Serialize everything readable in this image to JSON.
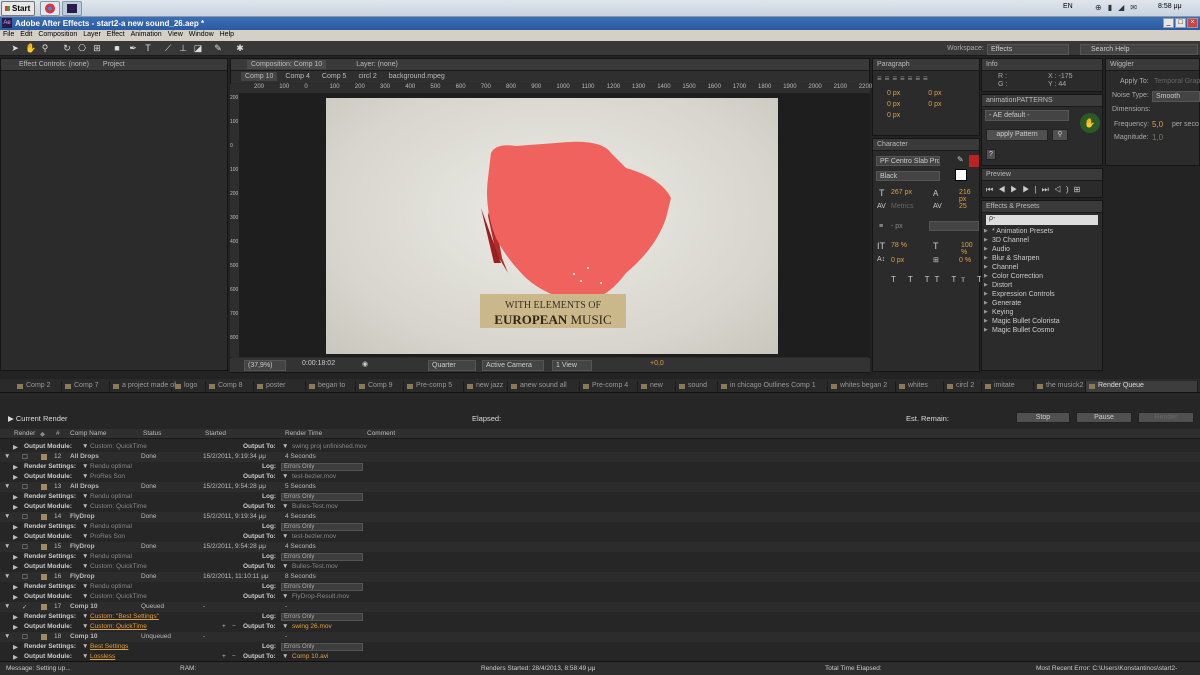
{
  "taskbar": {
    "start": "Start",
    "lang": "EN",
    "clock": "8:58 μμ"
  },
  "window": {
    "title": "Adobe After Effects - start2-a new sound_26.aep *",
    "icon": "Ae"
  },
  "menu": [
    "File",
    "Edit",
    "Composition",
    "Layer",
    "Effect",
    "Animation",
    "View",
    "Window",
    "Help"
  ],
  "workspace": {
    "label": "Workspace:",
    "value": "Effects",
    "search": "Search Help"
  },
  "left_panel": {
    "tab1": "Effect Controls: (none)",
    "tab2": "Project"
  },
  "comp_panel": {
    "tab": "Composition: Comp 10",
    "layer": "Layer: (none)",
    "subtabs": [
      "Comp 10",
      "Comp 4",
      "Comp 5",
      "circl 2",
      "background.mpeg"
    ],
    "ruler_top": [
      "200",
      "100",
      "0",
      "100",
      "200",
      "300",
      "400",
      "500",
      "600",
      "700",
      "800",
      "900",
      "1000",
      "1100",
      "1200",
      "1300",
      "1400",
      "1500",
      "1600",
      "1700",
      "1800",
      "1900",
      "2000",
      "2100",
      "2200"
    ],
    "ruler_left": [
      "200",
      "100",
      "0",
      "100",
      "200",
      "300",
      "400",
      "500",
      "600",
      "700",
      "800"
    ],
    "zoom": "(37,9%)",
    "timecode": "0:00:18:02",
    "quality": "Quarter",
    "camera": "Active Camera",
    "view": "1 View",
    "exposure": "+0,0"
  },
  "canvas_text": {
    "line1": "WITH ELEMENTS OF",
    "line2a": "EUROPEAN",
    "line2b": "MUSIC"
  },
  "paragraph": {
    "title": "Paragraph",
    "v1": "0 px",
    "v2": "0 px",
    "v3": "0 px",
    "v4": "0 px",
    "v5": "0 px"
  },
  "info": {
    "title": "Info",
    "r": "R :",
    "g": "G :",
    "x": "X : -175",
    "y": "Y : 44"
  },
  "wiggler": {
    "title": "Wiggler",
    "apply_to": "Apply To:",
    "apply_val": "Temporal Graph",
    "noise": "Noise Type:",
    "noise_val": "Smooth",
    "dims": "Dimensions:",
    "freq": "Frequency:",
    "freq_val": "5,0",
    "per": "per seco",
    "mag": "Magnitude:",
    "mag_val": "1,0"
  },
  "anim": {
    "title": "animationPATTERNS",
    "preset": "- AE default -",
    "apply": "apply Pattern",
    "help": "?"
  },
  "character": {
    "title": "Character",
    "font": "PF Centro Slab Pro",
    "style": "Black",
    "size": "267 px",
    "leading": "216 px",
    "metrics": "Metrics",
    "tracking": "25",
    "stroke": "- px",
    "vscale": "78 %",
    "hscale": "100 %",
    "baseline": "0 px",
    "tsume": "0 %"
  },
  "preview": {
    "title": "Preview"
  },
  "effects": {
    "title": "Effects & Presets",
    "search": "ρ-",
    "items": [
      "* Animation Presets",
      "3D Channel",
      "Audio",
      "Blur & Sharpen",
      "Channel",
      "Color Correction",
      "Distort",
      "Expression Controls",
      "Generate",
      "Keying",
      "Magic Bullet Colorista",
      "Magic Bullet Cosmo"
    ]
  },
  "timeline_tabs": [
    "Comp 2",
    "Comp 7",
    "a project made of",
    "logo",
    "Comp 8",
    "poster",
    "began to",
    "Comp 9",
    "Pre-comp 5",
    "new jazz",
    "anew sound all",
    "Pre-comp 4",
    "new",
    "sound",
    "in chicago Outlines Comp 1",
    "whites began 2",
    "whites",
    "circl 2",
    "imitate",
    "the musick2",
    "Render Queue"
  ],
  "render": {
    "current": "Current Render",
    "elapsed": "Elapsed:",
    "remain": "Est. Remain:",
    "stop": "Stop",
    "pause": "Pause",
    "render": "Render",
    "cols": [
      "Render",
      "#",
      "Comp Name",
      "Status",
      "Started",
      "Render Time",
      "Comment"
    ],
    "rows": [
      {
        "t": "om",
        "label": "Output Module:",
        "val": "Custom: QuickTime",
        "out": "swing proj unfinished.mov"
      },
      {
        "t": "item",
        "num": "12",
        "name": "All Drops",
        "status": "Done",
        "started": "15/2/2011, 9:19:34 μμ",
        "time": "4 Seconds"
      },
      {
        "t": "rs",
        "label": "Render Settings:",
        "val": "Rendu optimal",
        "log": "Errors Only"
      },
      {
        "t": "om",
        "label": "Output Module:",
        "val": "ProRes Son",
        "out": "test-bezier.mov"
      },
      {
        "t": "item",
        "num": "13",
        "name": "All Drops",
        "status": "Done",
        "started": "15/2/2011, 9:54:28 μμ",
        "time": "5 Seconds"
      },
      {
        "t": "rs",
        "label": "Render Settings:",
        "val": "Rendu optimal",
        "log": "Errors Only"
      },
      {
        "t": "om",
        "label": "Output Module:",
        "val": "Custom: QuickTime",
        "out": "Bulles-Test.mov"
      },
      {
        "t": "item",
        "num": "14",
        "name": "FlyDrop",
        "status": "Done",
        "started": "15/2/2011, 9:19:34 μμ",
        "time": "4 Seconds"
      },
      {
        "t": "rs",
        "label": "Render Settings:",
        "val": "Rendu optimal",
        "log": "Errors Only"
      },
      {
        "t": "om",
        "label": "Output Module:",
        "val": "ProRes Son",
        "out": "test-bezier.mov"
      },
      {
        "t": "item",
        "num": "15",
        "name": "FlyDrop",
        "status": "Done",
        "started": "15/2/2011, 9:54:28 μμ",
        "time": "4 Seconds"
      },
      {
        "t": "rs",
        "label": "Render Settings:",
        "val": "Rendu optimal",
        "log": "Errors Only"
      },
      {
        "t": "om",
        "label": "Output Module:",
        "val": "Custom: QuickTime",
        "out": "Bulles-Test.mov"
      },
      {
        "t": "item",
        "num": "16",
        "name": "FlyDrop",
        "status": "Done",
        "started": "16/2/2011, 11:10:11 μμ",
        "time": "8 Seconds"
      },
      {
        "t": "rs",
        "label": "Render Settings:",
        "val": "Rendu optimal",
        "log": "Errors Only"
      },
      {
        "t": "om",
        "label": "Output Module:",
        "val": "Custom: QuickTime",
        "out": "FlyDrop-Result.mov"
      },
      {
        "t": "item",
        "num": "17",
        "name": "Comp 10",
        "status": "Queued",
        "started": "-",
        "time": "-",
        "check": "✓"
      },
      {
        "t": "rs",
        "label": "Render Settings:",
        "val": "Custom: \"Best Settings\"",
        "log": "Errors Only",
        "hl": true
      },
      {
        "t": "om",
        "label": "Output Module:",
        "val": "Custom: QuickTime",
        "out": "swing 26.mov",
        "hl": true
      },
      {
        "t": "item",
        "num": "18",
        "name": "Comp 10",
        "status": "Unqueued",
        "started": "-",
        "time": "-"
      },
      {
        "t": "rs",
        "label": "Render Settings:",
        "val": "Best Settings",
        "log": "Errors Only",
        "hl": true
      },
      {
        "t": "om",
        "label": "Output Module:",
        "val": "Lossless",
        "out": "Comp 10.avi",
        "hl": true
      }
    ]
  },
  "status_bar": {
    "message": "Message: Setting up...",
    "ram": "RAM:",
    "started": "Renders Started: 28/4/2013, 8:58:49 μμ",
    "total": "Total Time Elapsed:",
    "error": "Most Recent Error: C:\\Users\\Konstantinos\\start2-"
  }
}
